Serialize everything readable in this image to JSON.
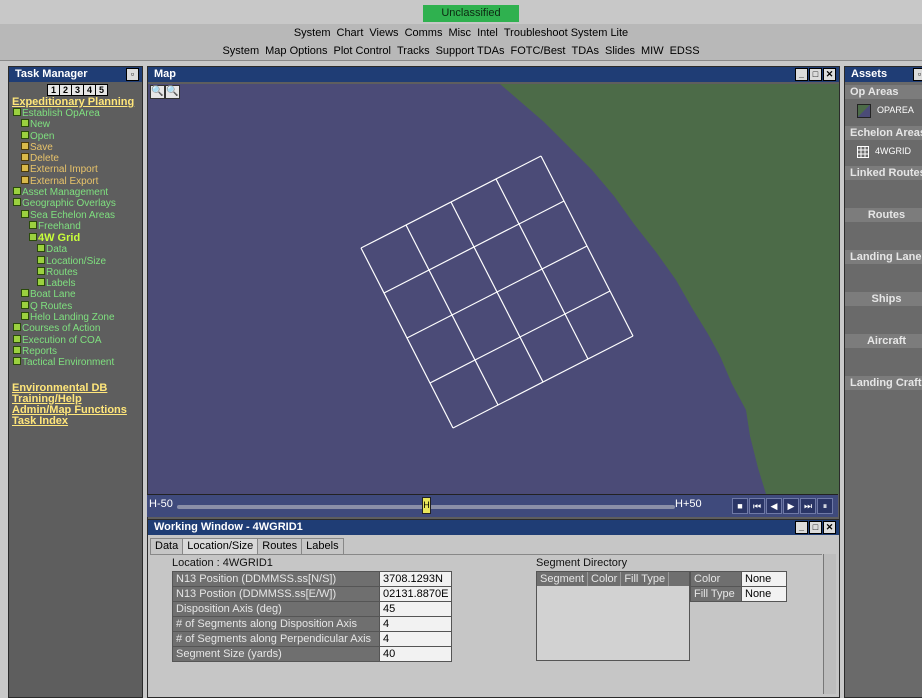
{
  "classification": "Unclassified",
  "menu_bar_1": [
    "System",
    "Chart",
    "Views",
    "Comms",
    "Misc",
    "Intel",
    "Troubleshoot System Lite"
  ],
  "menu_bar_2": [
    "System",
    "Map Options",
    "Plot Control",
    "Tracks",
    "Support TDAs",
    "FOTC/Best",
    "TDAs",
    "Slides",
    "MIW",
    "EDSS"
  ],
  "task_manager": {
    "title": "Task Manager",
    "tabs": [
      "1",
      "2",
      "3",
      "4",
      "5"
    ],
    "section_title": "Expeditionary Planning",
    "items": [
      {
        "label": "Establish OpArea",
        "indent": 0,
        "color": "green"
      },
      {
        "label": "New",
        "indent": 1,
        "color": "green"
      },
      {
        "label": "Open",
        "indent": 1,
        "color": "green"
      },
      {
        "label": "Save",
        "indent": 1,
        "color": "orange"
      },
      {
        "label": "Delete",
        "indent": 1,
        "color": "orange"
      },
      {
        "label": "External Import",
        "indent": 1,
        "color": "orange"
      },
      {
        "label": "External Export",
        "indent": 1,
        "color": "orange"
      },
      {
        "label": "Asset Management",
        "indent": 0,
        "color": "green"
      },
      {
        "label": "Geographic Overlays",
        "indent": 0,
        "color": "green"
      },
      {
        "label": "Sea Echelon Areas",
        "indent": 1,
        "color": "green"
      },
      {
        "label": "Freehand",
        "indent": 2,
        "color": "green"
      },
      {
        "label": "4W Grid",
        "indent": 2,
        "color": "selected"
      },
      {
        "label": "Data",
        "indent": 3,
        "color": "green"
      },
      {
        "label": "Location/Size",
        "indent": 3,
        "color": "green"
      },
      {
        "label": "Routes",
        "indent": 3,
        "color": "green"
      },
      {
        "label": "Labels",
        "indent": 3,
        "color": "green"
      },
      {
        "label": "Boat Lane",
        "indent": 1,
        "color": "green"
      },
      {
        "label": "Q Routes",
        "indent": 1,
        "color": "green"
      },
      {
        "label": "Helo Landing Zone",
        "indent": 1,
        "color": "green"
      },
      {
        "label": "Courses of Action",
        "indent": 0,
        "color": "green"
      },
      {
        "label": "Execution of COA",
        "indent": 0,
        "color": "green"
      },
      {
        "label": "Reports",
        "indent": 0,
        "color": "green"
      },
      {
        "label": "Tactical Environment",
        "indent": 0,
        "color": "green"
      }
    ],
    "bottom_links": [
      "Environmental DB",
      "Training/Help",
      "Admin/Map Functions",
      "Task Index"
    ]
  },
  "map": {
    "title": "Map",
    "colors": {
      "sea": "#4b4b77",
      "land": "#4c6b48",
      "grid": "#ffffff"
    },
    "grid_segments": 4
  },
  "timeline": {
    "start_label": "H-50",
    "end_label": "H+50",
    "thumb_label": "H",
    "position": 0.5
  },
  "working_window": {
    "title": "Working Window - 4WGRID1",
    "tabs": [
      "Data",
      "Location/Size",
      "Routes",
      "Labels"
    ],
    "active_tab": "Location/Size",
    "location_label": "Location : 4WGRID1",
    "fields": [
      {
        "label": "N13 Position (DDMMSS.ss[N/S])",
        "value": "3708.1293N"
      },
      {
        "label": "N13 Postion (DDMMSS.ss[E/W])",
        "value": "02131.8870E"
      },
      {
        "label": "Disposition Axis (deg)",
        "value": "45"
      },
      {
        "label": "# of Segments along Disposition Axis",
        "value": "4"
      },
      {
        "label": "# of Segments along Perpendicular Axis",
        "value": "4"
      },
      {
        "label": "Segment Size (yards)",
        "value": "40"
      }
    ],
    "segment_directory": {
      "title": "Segment Directory",
      "columns": [
        "Segment",
        "Color",
        "Fill Type"
      ]
    },
    "color_label": "Color",
    "color_value": "None",
    "fill_label": "Fill Type",
    "fill_value": "None"
  },
  "assets": {
    "title": "Assets",
    "sections": {
      "op_areas": "Op Areas",
      "op_area_item": "OPAREA",
      "echelon_areas": "Echelon Areas",
      "echelon_item": "4WGRID",
      "linked_routes": "Linked Routes",
      "routes": "Routes",
      "landing_lanes": "Landing Lanes",
      "ships": "Ships",
      "aircraft": "Aircraft",
      "landing_craft": "Landing Craft"
    }
  }
}
